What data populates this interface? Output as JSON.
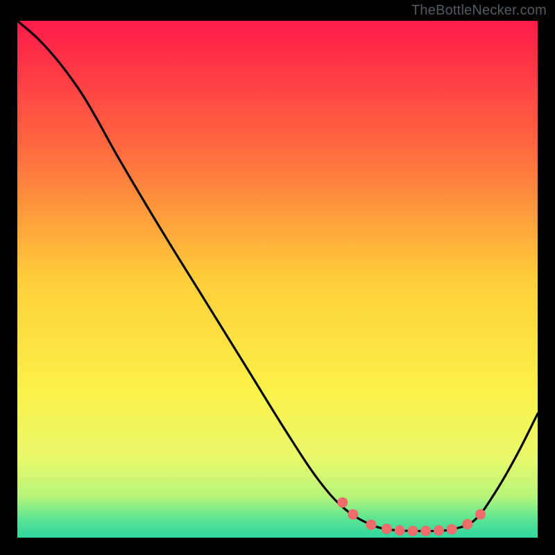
{
  "attribution": "TheBottleNecker.com",
  "chart_data": {
    "type": "line",
    "title": "",
    "xlabel": "",
    "ylabel": "",
    "xlim": [
      0,
      100
    ],
    "ylim": [
      0,
      100
    ],
    "gradient_stops": [
      {
        "offset": 0,
        "color": "#ff1a4b"
      },
      {
        "offset": 25,
        "color": "#ff6a3f"
      },
      {
        "offset": 50,
        "color": "#ffce3a"
      },
      {
        "offset": 72,
        "color": "#faf24a"
      },
      {
        "offset": 85,
        "color": "#e8f86c"
      },
      {
        "offset": 92,
        "color": "#b7f57a"
      },
      {
        "offset": 96,
        "color": "#63e690"
      },
      {
        "offset": 100,
        "color": "#2fd6a0"
      }
    ],
    "curve": [
      {
        "x": 0,
        "y": 100
      },
      {
        "x": 4,
        "y": 96.5
      },
      {
        "x": 8,
        "y": 92.0
      },
      {
        "x": 12,
        "y": 86.5
      },
      {
        "x": 15,
        "y": 81.5
      },
      {
        "x": 20,
        "y": 72.5
      },
      {
        "x": 28,
        "y": 59.0
      },
      {
        "x": 36,
        "y": 46.0
      },
      {
        "x": 44,
        "y": 33.0
      },
      {
        "x": 52,
        "y": 20.0
      },
      {
        "x": 58,
        "y": 11.0
      },
      {
        "x": 63,
        "y": 5.5
      },
      {
        "x": 68,
        "y": 2.5
      },
      {
        "x": 72,
        "y": 1.5
      },
      {
        "x": 76,
        "y": 1.3
      },
      {
        "x": 80,
        "y": 1.3
      },
      {
        "x": 84,
        "y": 1.7
      },
      {
        "x": 88,
        "y": 3.5
      },
      {
        "x": 92,
        "y": 9.0
      },
      {
        "x": 96,
        "y": 16.0
      },
      {
        "x": 100,
        "y": 24.0
      }
    ],
    "markers": [
      {
        "x": 62.5,
        "y": 6.8
      },
      {
        "x": 64.5,
        "y": 4.5
      },
      {
        "x": 68.0,
        "y": 2.5
      },
      {
        "x": 71.0,
        "y": 1.7
      },
      {
        "x": 73.5,
        "y": 1.4
      },
      {
        "x": 76.0,
        "y": 1.3
      },
      {
        "x": 78.5,
        "y": 1.3
      },
      {
        "x": 81.0,
        "y": 1.4
      },
      {
        "x": 83.5,
        "y": 1.6
      },
      {
        "x": 86.5,
        "y": 2.6
      },
      {
        "x": 89.0,
        "y": 4.5
      }
    ]
  }
}
